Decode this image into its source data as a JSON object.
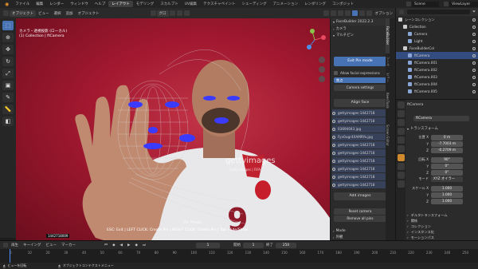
{
  "topbar": {
    "menus": [
      "ファイル",
      "編集",
      "レンダー",
      "ウィンドウ",
      "ヘルプ"
    ],
    "workspaces": [
      {
        "label": "レイアウト",
        "active": true
      },
      {
        "label": "モデリング",
        "active": false
      },
      {
        "label": "スカルプト",
        "active": false
      },
      {
        "label": "UV編集",
        "active": false
      },
      {
        "label": "テクスチャペイント",
        "active": false
      },
      {
        "label": "シェーディング",
        "active": false
      },
      {
        "label": "アニメーション",
        "active": false
      },
      {
        "label": "レンダリング",
        "active": false
      },
      {
        "label": "コンポジット",
        "active": false
      }
    ],
    "scene": "Scene",
    "view_layer": "ViewLayer"
  },
  "header": {
    "mode": "オブジェクト",
    "menus": [
      "ビュー",
      "選択",
      "追加",
      "オブジェクト"
    ],
    "transform": "グロ",
    "options": "オプション"
  },
  "viewport": {
    "camera_label": "カメラ・透視投影 (ローカル)",
    "collection_label": "(1) Collection | ftCamera",
    "watermark_logo": "gettyimages",
    "watermark_credit": "Getty Images | FIFA",
    "pin_mode_text": "Pin Mode",
    "status_hint": "ESC: Exit | LEFT CLICK: Create Pin | RIGHT CLICK: Delete Pin | Tab: Hide/Show",
    "image_id": "1442718009",
    "accent": "#9e1530"
  },
  "npanel": {
    "title": "FaceBuilder 2022.2.3",
    "camera_section": "カメラ",
    "multipin_section": "マルチピン",
    "exit_button": "Exit Pin mode",
    "allow_label": "Allow facial expressions",
    "focal_label": "焦点",
    "focal_value": "",
    "camera_settings": "Camera settings",
    "align_button": "Align face",
    "images": [
      "gettyimages-1442718",
      "gettyimages-1442718",
      "03694043.jpg",
      "Fyn0ugr4XAMRYa.jpg",
      "gettyimages-1442718",
      "gettyimages-1442718",
      "gettyimages-1442718",
      "gettyimages-1442718",
      "gettyimages-1442718",
      "gettyimages-1442718"
    ],
    "add_images": "Add images",
    "reset_camera": "Reset camera",
    "remove_pins": "Remove all pins",
    "mode_section": "Mode",
    "appearance_section": "外観",
    "tabs": [
      "FaceBuilder",
      "ツール",
      "ビュー",
      "KeenTools",
      "Screen Editor"
    ],
    "colors": {
      "button_blue": "#4772b3",
      "bg": "#2b2b2b"
    }
  },
  "outliner": {
    "title": "シーンコレクション",
    "items": [
      {
        "label": "シーンコレクション",
        "depth": 0,
        "selected": false
      },
      {
        "label": "Collection",
        "depth": 1,
        "selected": false
      },
      {
        "label": "Camera",
        "depth": 2,
        "selected": false
      },
      {
        "label": "Light",
        "depth": 2,
        "selected": false
      },
      {
        "label": "FaceBuilderCol",
        "depth": 1,
        "selected": false
      },
      {
        "label": "ftCamera",
        "depth": 2,
        "selected": true
      },
      {
        "label": "ftCamera.001",
        "depth": 2,
        "selected": false
      },
      {
        "label": "ftCamera.002",
        "depth": 2,
        "selected": false
      },
      {
        "label": "ftCamera.003",
        "depth": 2,
        "selected": false
      },
      {
        "label": "ftCamera.004",
        "depth": 2,
        "selected": false
      },
      {
        "label": "ftCamera.005",
        "depth": 2,
        "selected": false
      }
    ]
  },
  "properties": {
    "object_name": "ftCamera",
    "object_field": "ftCamera",
    "transform_section": "トランスフォーム",
    "location_label": "位置 X",
    "location": [
      "0 m",
      "-7.7003 m",
      "-0.2709 m"
    ],
    "rotation_label": "回転 X",
    "rotation": [
      "90°",
      "0°",
      "0°"
    ],
    "rotation_mode_label": "モード",
    "rotation_mode": "XYZ オイラー",
    "scale_label": "スケール X",
    "scale": [
      "1.000",
      "1.000",
      "1.000"
    ],
    "sections": [
      "デルタトランスフォーム",
      "関係",
      "コレクション",
      "インスタンス化",
      "モーションパス",
      "可視性",
      "ビューポート表示"
    ]
  },
  "timeline": {
    "menus": [
      "再生",
      "キーイング",
      "ビュー",
      "マーカー"
    ],
    "current_frame": "1",
    "start_label": "開始",
    "start": "1",
    "end_label": "終了",
    "end": "250",
    "ticks": [
      "0",
      "10",
      "20",
      "30",
      "40",
      "50",
      "60",
      "70",
      "80",
      "90",
      "100",
      "110",
      "120",
      "130",
      "140",
      "150",
      "160",
      "170",
      "180",
      "190",
      "200",
      "210",
      "220",
      "230",
      "240",
      "250"
    ],
    "status_left": "ビューを回転",
    "status_mid": "オブジェクトコンテクストメニュー"
  }
}
